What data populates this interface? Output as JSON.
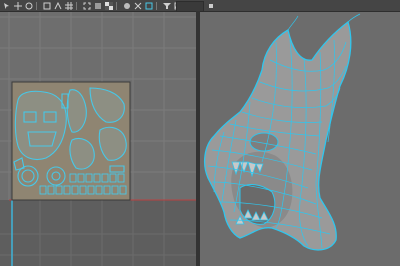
{
  "toolbar": {
    "tools": [
      {
        "icon": "select-icon"
      },
      {
        "icon": "move-icon"
      },
      {
        "icon": "rotate-icon"
      },
      {
        "icon": "scale-icon"
      },
      {
        "icon": "snap-icon"
      },
      {
        "icon": "grid-icon"
      },
      {
        "icon": "frame-icon"
      },
      {
        "icon": "texture-icon"
      },
      {
        "icon": "checker-icon"
      },
      {
        "icon": "shading-icon"
      },
      {
        "icon": "wireframe-icon"
      },
      {
        "icon": "border-icon"
      },
      {
        "icon": "filter-icon"
      },
      {
        "icon": "image-icon"
      },
      {
        "icon": "rgb-icon"
      },
      {
        "icon": "alpha-icon"
      },
      {
        "icon": "pixel-icon"
      }
    ]
  },
  "uv_editor": {
    "background": "#6e6e6e",
    "uv_color": "#47c8e8",
    "texture_tile": "#8f8572"
  },
  "viewport": {
    "background": "#6c6c6c",
    "mesh_fill": "#9a9a9a",
    "wire_color": "#2fc6ee"
  }
}
